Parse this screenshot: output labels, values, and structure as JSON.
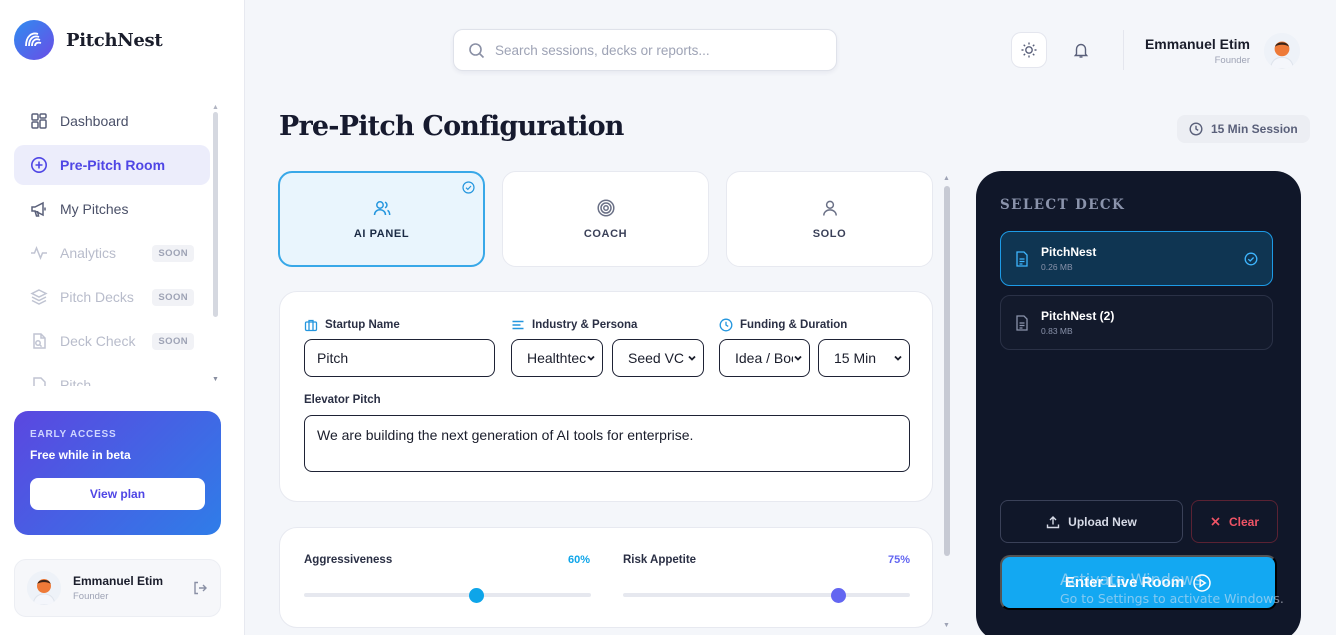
{
  "brand": {
    "name": "PitchNest",
    "logo_text": "PITCHNEST"
  },
  "sidebar": {
    "items": [
      {
        "label": "Dashboard",
        "icon": "dashboard-icon",
        "state": "normal",
        "badge": ""
      },
      {
        "label": "Pre-Pitch Room",
        "icon": "plus-circle-icon",
        "state": "active",
        "badge": ""
      },
      {
        "label": "My Pitches",
        "icon": "megaphone-icon",
        "state": "normal",
        "badge": ""
      },
      {
        "label": "Analytics",
        "icon": "pulse-icon",
        "state": "disabled",
        "badge": "SOON"
      },
      {
        "label": "Pitch Decks",
        "icon": "layers-icon",
        "state": "disabled",
        "badge": "SOON"
      },
      {
        "label": "Deck Check",
        "icon": "file-search-icon",
        "state": "disabled",
        "badge": "SOON"
      },
      {
        "label": "Pitch",
        "icon": "file-icon",
        "state": "disabled",
        "badge": ""
      }
    ],
    "promo": {
      "eyebrow": "EARLY ACCESS",
      "title": "Free while in beta",
      "button": "View plan"
    },
    "user": {
      "name": "Emmanuel Etim",
      "role": "Founder"
    }
  },
  "header": {
    "search_placeholder": "Search sessions, decks or reports...",
    "user": {
      "name": "Emmanuel Etim",
      "role": "Founder"
    }
  },
  "page": {
    "title": "Pre-Pitch Configuration",
    "session_pill": "15 Min Session"
  },
  "modes": [
    {
      "label": "AI PANEL",
      "icon": "users-icon",
      "selected": true
    },
    {
      "label": "COACH",
      "icon": "target-icon",
      "selected": false
    },
    {
      "label": "SOLO",
      "icon": "user-icon",
      "selected": false
    }
  ],
  "form": {
    "startup_label": "Startup Name",
    "startup_value": "Pitch",
    "industry_label": "Industry & Persona",
    "industry_value": "Healthtech",
    "persona_value": "Seed VC",
    "funding_label": "Funding & Duration",
    "funding_value": "Idea / Bootstrapped",
    "duration_value": "15 Min",
    "elevator_label": "Elevator Pitch",
    "elevator_value": "We are building the next generation of AI tools for enterprise."
  },
  "sliders": [
    {
      "label": "Aggressiveness",
      "value_text": "60%",
      "value": 0.6,
      "color": "#0ea5e9"
    },
    {
      "label": "Risk Appetite",
      "value_text": "75%",
      "value": 0.75,
      "color": "#6366f1"
    }
  ],
  "deck": {
    "title": "SELECT DECK",
    "items": [
      {
        "name": "PitchNest",
        "size": "0.26 MB",
        "selected": true
      },
      {
        "name": "PitchNest (2)",
        "size": "0.83 MB",
        "selected": false
      }
    ],
    "upload_label": "Upload New",
    "clear_label": "Clear",
    "enter_label": "Enter Live Room"
  },
  "watermark": {
    "line1": "Activate Windows",
    "line2": "Go to Settings to activate Windows."
  },
  "colors": {
    "accent": "#4f46e5",
    "primary": "#13a8f2",
    "danger": "#f05466",
    "panel": "#101729"
  }
}
